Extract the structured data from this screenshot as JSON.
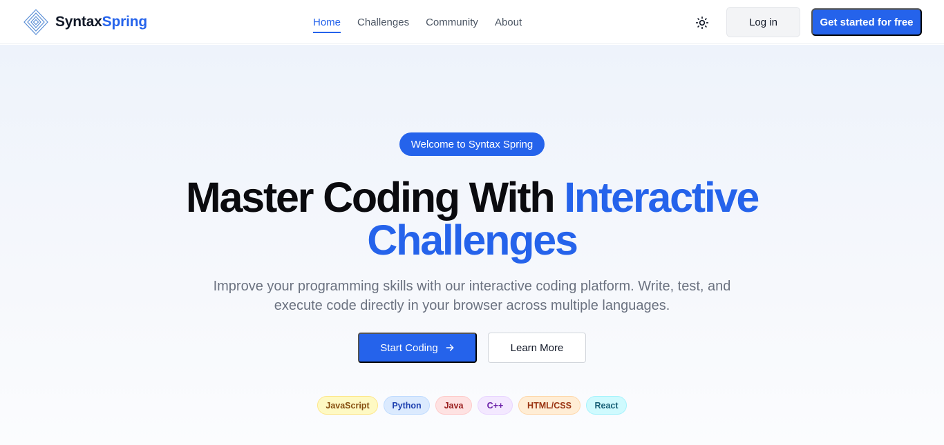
{
  "brand": {
    "name_part1": "Syntax",
    "name_part2": "Spring"
  },
  "nav": {
    "items": [
      {
        "label": "Home",
        "active": true
      },
      {
        "label": "Challenges",
        "active": false
      },
      {
        "label": "Community",
        "active": false
      },
      {
        "label": "About",
        "active": false
      }
    ]
  },
  "header": {
    "theme_icon": "sun-icon",
    "login_label": "Log in",
    "cta_label": "Get started for free"
  },
  "hero": {
    "badge": "Welcome to Syntax Spring",
    "headline_part1": "Master Coding With ",
    "headline_part2": "Interactive Challenges",
    "subtitle": "Improve your programming skills with our interactive coding platform. Write, test, and execute code directly in your browser across multiple languages.",
    "start_label": "Start Coding",
    "start_icon": "arrow-right-icon",
    "learn_label": "Learn More"
  },
  "languages": [
    {
      "label": "JavaScript",
      "bg": "#fef9c3",
      "fg": "#854d0e",
      "border": "#fde68a"
    },
    {
      "label": "Python",
      "bg": "#dbeafe",
      "fg": "#1e40af",
      "border": "#bfdbfe"
    },
    {
      "label": "Java",
      "bg": "#fee2e2",
      "fg": "#991b1b",
      "border": "#fecaca"
    },
    {
      "label": "C++",
      "bg": "#f3e8ff",
      "fg": "#6b21a8",
      "border": "#e9d5ff"
    },
    {
      "label": "HTML/CSS",
      "bg": "#ffedd5",
      "fg": "#9a3412",
      "border": "#fed7aa"
    },
    {
      "label": "React",
      "bg": "#cffafe",
      "fg": "#155e75",
      "border": "#a5f3fc"
    }
  ],
  "colors": {
    "accent": "#2563eb"
  }
}
